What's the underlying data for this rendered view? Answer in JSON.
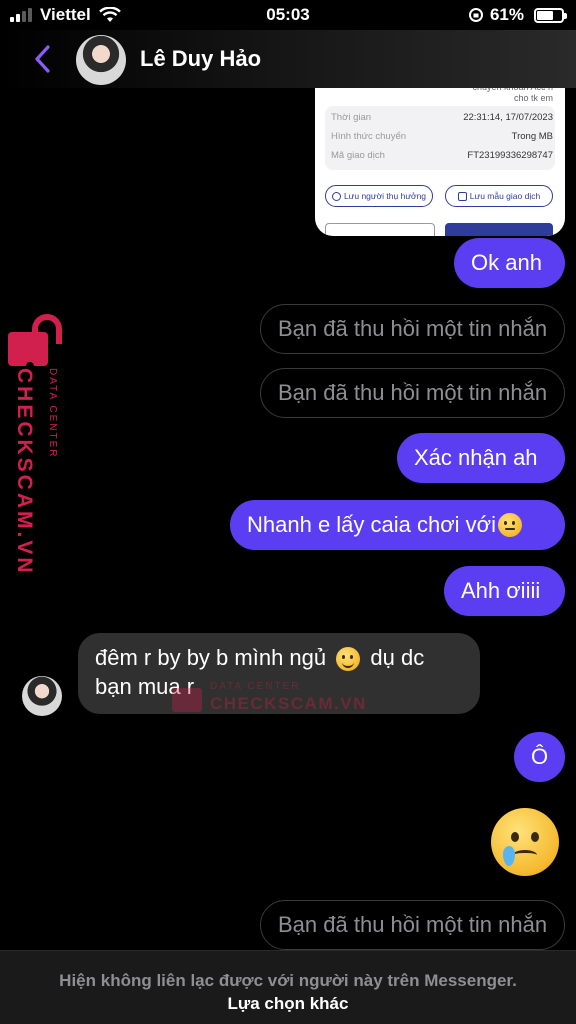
{
  "status_bar": {
    "carrier": "Viettel",
    "time": "05:03",
    "battery_percent": "61%",
    "battery_level": 0.61
  },
  "header": {
    "contact_name": "Lê Duy Hảo"
  },
  "shared_image": {
    "top_text": "chuyển khoản Acc n\ncho tk em",
    "rows": [
      {
        "key": "Thời gian",
        "value": "22:31:14, 17/07/2023"
      },
      {
        "key": "Hình thức chuyển",
        "value": "Trong MB"
      },
      {
        "key": "Mã giao dịch",
        "value": "FT23199336298747"
      }
    ],
    "btn_left": "Lưu người thụ hưởng",
    "btn_right": "Lưu mẫu giao dịch"
  },
  "messages": [
    {
      "type": "sent",
      "text": "Ok anh"
    },
    {
      "type": "recalled",
      "text": "Bạn đã thu hồi một tin nhắn"
    },
    {
      "type": "recalled",
      "text": "Bạn đã thu hồi một tin nhắn"
    },
    {
      "type": "sent",
      "text": "Xác nhận ah"
    },
    {
      "type": "sent",
      "text": "Nhanh e lấy caia chơi với",
      "emoji": "neutral-face"
    },
    {
      "type": "sent",
      "text": "Ahh ơiiii"
    },
    {
      "type": "received",
      "line1": "đêm r by by b mình ngủ",
      "line1_after": "dụ dc",
      "line2": "bạn mua r",
      "emoji": "smiling-face"
    },
    {
      "type": "sent",
      "text": "Ô"
    },
    {
      "type": "sent",
      "emoji": "crying-face"
    },
    {
      "type": "recalled",
      "text": "Bạn đã thu hồi một tin nhắn"
    }
  ],
  "watermark": {
    "line_small": "DATA CENTER",
    "line_big": "CHECKSCAM.VN",
    "color": "#d2204e"
  },
  "footer": {
    "note": "Hiện không liên lạc được với người này trên Messenger.",
    "link": "Lựa chọn khác"
  },
  "colors": {
    "sent_bubble": "#5c3ef2",
    "received_bubble": "#303030",
    "accent": "#8b5cf6"
  }
}
